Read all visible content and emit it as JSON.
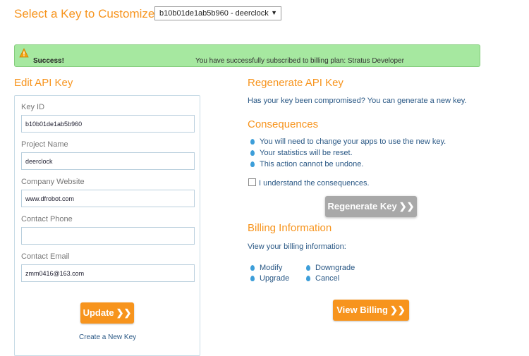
{
  "header": {
    "title": "Select a Key to Customize",
    "key_select_value": "b10b01de1ab5b960 - deerclock"
  },
  "alert": {
    "label": "Success!",
    "message": "You have successfully subscribed to billing plan: Stratus Developer"
  },
  "edit": {
    "title": "Edit API Key",
    "key_id_label": "Key ID",
    "key_id_value": "b10b01de1ab5b960",
    "project_name_label": "Project Name",
    "project_name_value": "deerclock",
    "company_website_label": "Company Website",
    "company_website_value": "www.dfrobot.com",
    "contact_phone_label": "Contact Phone",
    "contact_phone_value": "",
    "contact_email_label": "Contact Email",
    "contact_email_value": "zmm0416@163.com",
    "update_button": "Update",
    "create_link": "Create a New Key"
  },
  "regenerate": {
    "title": "Regenerate API Key",
    "description": "Has your key been compromised? You can generate a new key.",
    "consequences_title": "Consequences",
    "consequences": [
      "You will need to change your apps to use the new key.",
      "Your statistics will be reset.",
      "This action cannot be undone."
    ],
    "checkbox_label": "I understand the consequences.",
    "button": "Regenerate Key"
  },
  "billing": {
    "title": "Billing Information",
    "description": "View your billing information:",
    "links": [
      "Modify",
      "Downgrade",
      "Upgrade",
      "Cancel"
    ],
    "button": "View Billing"
  },
  "colors": {
    "accent": "#f7941d",
    "link": "#2a5885",
    "success_bg": "#a6e8a0",
    "bullet": "#3d9ed9"
  }
}
